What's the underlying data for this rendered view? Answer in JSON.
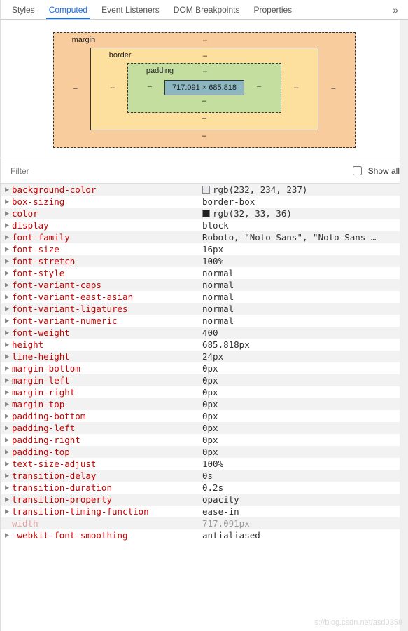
{
  "tabs": {
    "items": [
      "Styles",
      "Computed",
      "Event Listeners",
      "DOM Breakpoints",
      "Properties"
    ],
    "active_index": 1,
    "more_glyph": "»"
  },
  "box_model": {
    "margin": {
      "label": "margin",
      "top": "–",
      "right": "–",
      "bottom": "–",
      "left": "–"
    },
    "border": {
      "label": "border",
      "top": "–",
      "right": "–",
      "bottom": "–",
      "left": "–"
    },
    "padding": {
      "label": "padding",
      "top": "–",
      "right": "–",
      "bottom": "–",
      "left": "–"
    },
    "content": "717.091 × 685.818"
  },
  "filter": {
    "placeholder": "Filter",
    "showall_label": "Show all",
    "showall_checked": false
  },
  "properties": [
    {
      "name": "background-color",
      "value": "rgb(232, 234, 237)",
      "swatch": "#e8eaed"
    },
    {
      "name": "box-sizing",
      "value": "border-box"
    },
    {
      "name": "color",
      "value": "rgb(32, 33, 36)",
      "swatch": "#202124"
    },
    {
      "name": "display",
      "value": "block"
    },
    {
      "name": "font-family",
      "value": "Roboto, \"Noto Sans\", \"Noto Sans …"
    },
    {
      "name": "font-size",
      "value": "16px"
    },
    {
      "name": "font-stretch",
      "value": "100%"
    },
    {
      "name": "font-style",
      "value": "normal"
    },
    {
      "name": "font-variant-caps",
      "value": "normal"
    },
    {
      "name": "font-variant-east-asian",
      "value": "normal"
    },
    {
      "name": "font-variant-ligatures",
      "value": "normal"
    },
    {
      "name": "font-variant-numeric",
      "value": "normal"
    },
    {
      "name": "font-weight",
      "value": "400"
    },
    {
      "name": "height",
      "value": "685.818px"
    },
    {
      "name": "line-height",
      "value": "24px"
    },
    {
      "name": "margin-bottom",
      "value": "0px"
    },
    {
      "name": "margin-left",
      "value": "0px"
    },
    {
      "name": "margin-right",
      "value": "0px"
    },
    {
      "name": "margin-top",
      "value": "0px"
    },
    {
      "name": "padding-bottom",
      "value": "0px"
    },
    {
      "name": "padding-left",
      "value": "0px"
    },
    {
      "name": "padding-right",
      "value": "0px"
    },
    {
      "name": "padding-top",
      "value": "0px"
    },
    {
      "name": "text-size-adjust",
      "value": "100%"
    },
    {
      "name": "transition-delay",
      "value": "0s"
    },
    {
      "name": "transition-duration",
      "value": "0.2s"
    },
    {
      "name": "transition-property",
      "value": "opacity"
    },
    {
      "name": "transition-timing-function",
      "value": "ease-in"
    },
    {
      "name": "width",
      "value": "717.091px",
      "faded": true,
      "no_tri": true
    },
    {
      "name": "-webkit-font-smoothing",
      "value": "antialiased"
    }
  ],
  "watermark": "s://blog.csdn.net/asd0358"
}
